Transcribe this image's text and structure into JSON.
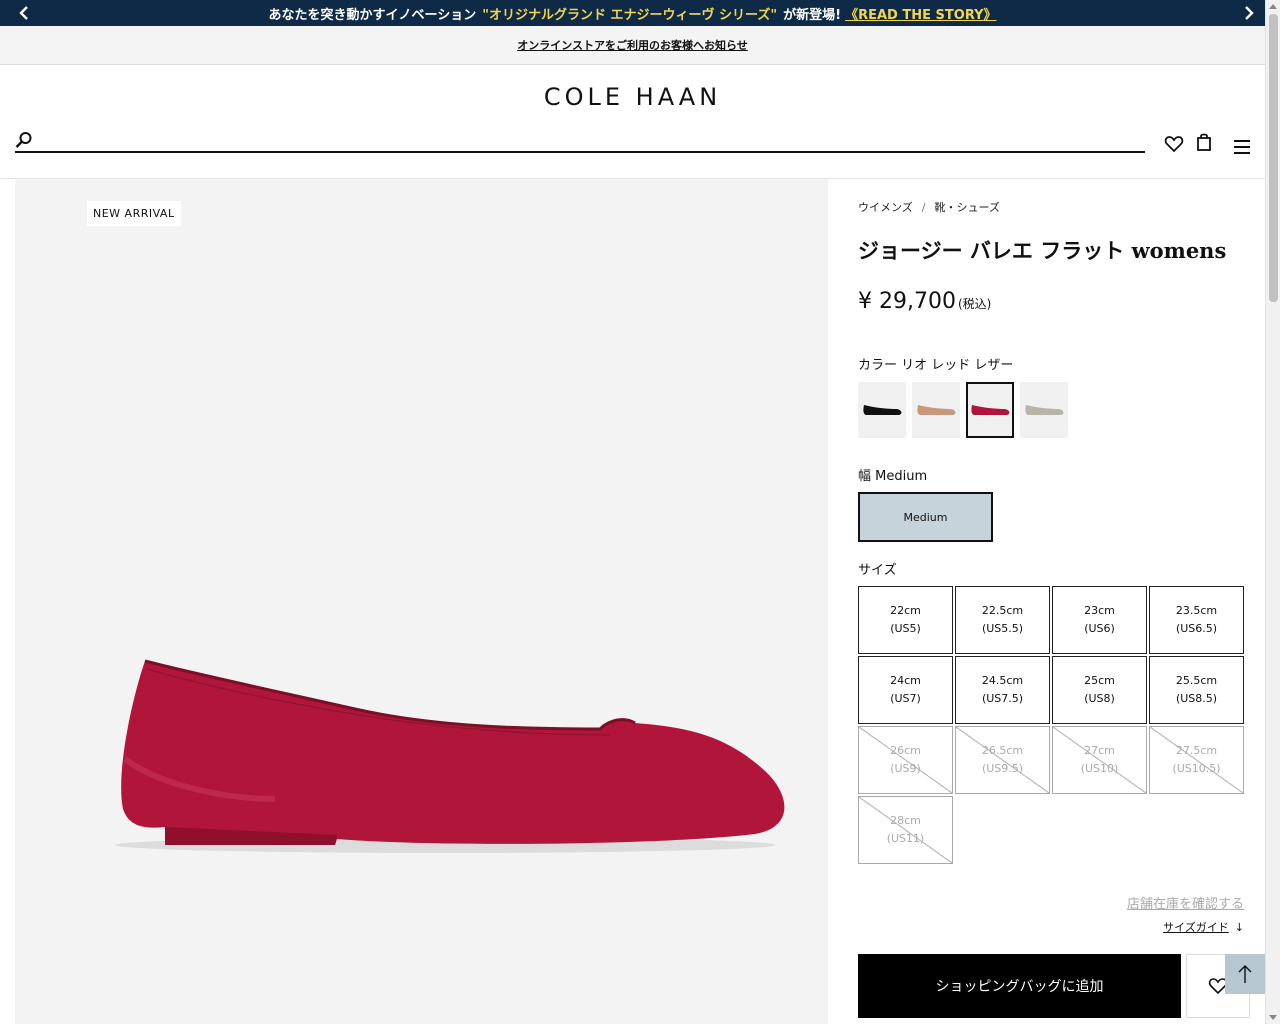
{
  "promo": {
    "text_before": "あなたを突き動かすイノベーション",
    "highlight": "\"オリジナルグランド エナジーウィーヴ シリーズ\"",
    "text_after": "が新登場!",
    "link": "《READ THE STORY》"
  },
  "notice": {
    "link": "オンラインストアをご利用のお客様へお知らせ"
  },
  "header": {
    "logo": "COLE HAAN",
    "search_placeholder": ""
  },
  "product": {
    "badge": "NEW ARRIVAL",
    "breadcrumbs": [
      "ウイメンズ",
      "靴・シューズ"
    ],
    "breadcrumb_sep": "/",
    "title": "ジョージー バレエ フラット womens",
    "price": "¥ 29,700",
    "price_note": "(税込)",
    "color_label": "カラー リオ レッド レザー",
    "swatches": [
      {
        "name": "black",
        "color": "#111111"
      },
      {
        "name": "tan",
        "color": "#c9987a"
      },
      {
        "name": "rio-red",
        "color": "#b1163a"
      },
      {
        "name": "silver",
        "color": "#b8b4a8"
      }
    ],
    "width_label": "幅 Medium",
    "width_option": "Medium",
    "size_label": "サイズ",
    "sizes": [
      {
        "cm": "22cm",
        "us": "(US5)",
        "available": true
      },
      {
        "cm": "22.5cm",
        "us": "(US5.5)",
        "available": true
      },
      {
        "cm": "23cm",
        "us": "(US6)",
        "available": true
      },
      {
        "cm": "23.5cm",
        "us": "(US6.5)",
        "available": true
      },
      {
        "cm": "24cm",
        "us": "(US7)",
        "available": true
      },
      {
        "cm": "24.5cm",
        "us": "(US7.5)",
        "available": true
      },
      {
        "cm": "25cm",
        "us": "(US8)",
        "available": true
      },
      {
        "cm": "25.5cm",
        "us": "(US8.5)",
        "available": true
      },
      {
        "cm": "26cm",
        "us": "(US9)",
        "available": false
      },
      {
        "cm": "26.5cm",
        "us": "(US9.5)",
        "available": false
      },
      {
        "cm": "27cm",
        "us": "(US10)",
        "available": false
      },
      {
        "cm": "27.5cm",
        "us": "(US10.5)",
        "available": false
      },
      {
        "cm": "28cm",
        "us": "(US11)",
        "available": false
      }
    ],
    "store_link": "店舗在庫を確認する",
    "size_guide": "サイズガイド",
    "size_guide_arrow": "↓",
    "add_to_bag": "ショッピングバッグに追加"
  },
  "colors": {
    "promo_bg": "#0e2a47",
    "promo_highlight": "#f3d54e",
    "shoe": "#b1163a",
    "width_selected": "#c7d3da"
  }
}
